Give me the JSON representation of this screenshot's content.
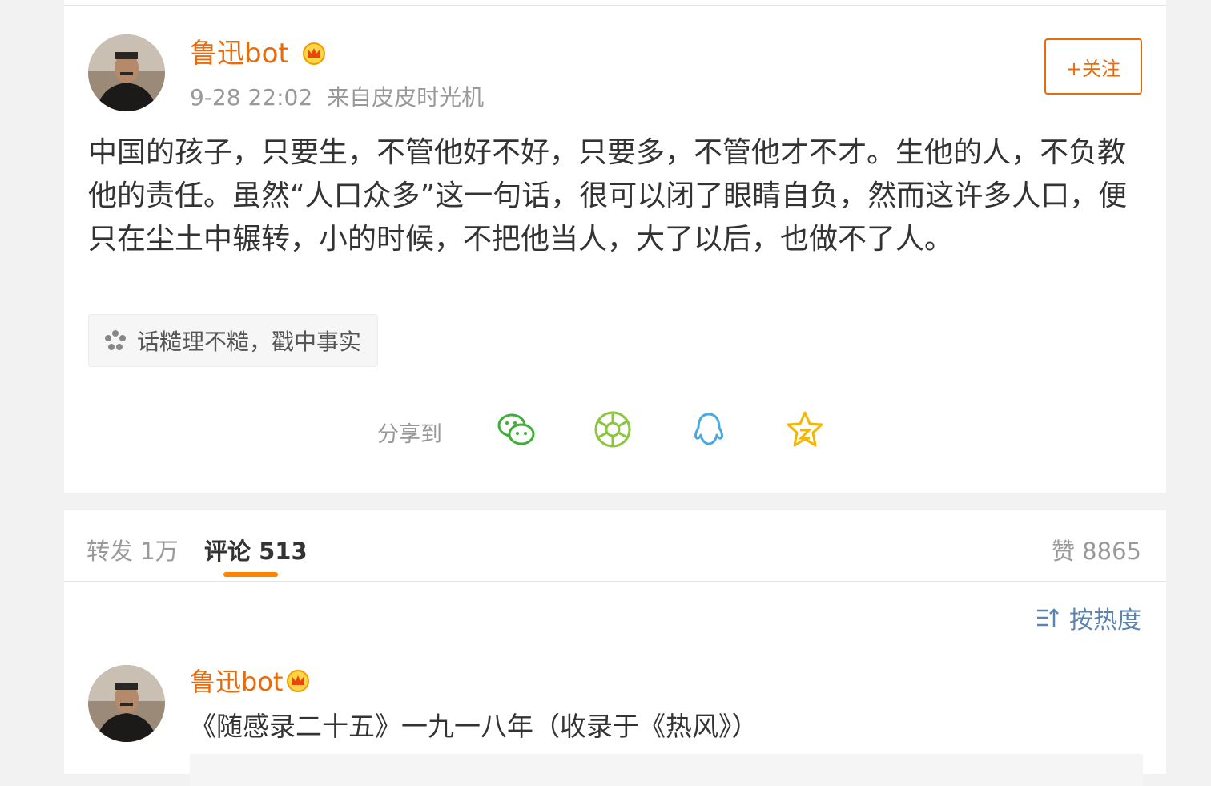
{
  "post": {
    "author": "鲁迅bot",
    "time": "9-28 22:02",
    "source": "来自皮皮时光机",
    "follow_label": "+关注",
    "text": "中国的孩子，只要生，不管他好不好，只要多，不管他才不才。生他的人，不负教他的责任。虽然“人口众多”这一句话，很可以闭了眼睛自负，然而这许多人口，便只在尘土中辗转，小的时候，不把他当人，大了以后，也做不了人。",
    "topic": "话糙理不糙，戳中事实",
    "share_label": "分享到",
    "share_targets": [
      {
        "icon": "wechat-icon",
        "color": "#3cb034"
      },
      {
        "icon": "moments-icon",
        "color": "#8cc63f"
      },
      {
        "icon": "qq-icon",
        "color": "#4aa8e0"
      },
      {
        "icon": "qzone-icon",
        "color": "#f6b500"
      }
    ]
  },
  "tabs": {
    "repost": "转发 1万",
    "comments": "评论 513",
    "likes": "赞 8865"
  },
  "sort_label": "按热度",
  "comment": {
    "author": "鲁迅bot",
    "text": "《随感录二十五》一九一八年（收录于《热风》）"
  },
  "colors": {
    "accent": "#ff8200",
    "author": "#e86b0c",
    "link": "#5b84b1"
  }
}
